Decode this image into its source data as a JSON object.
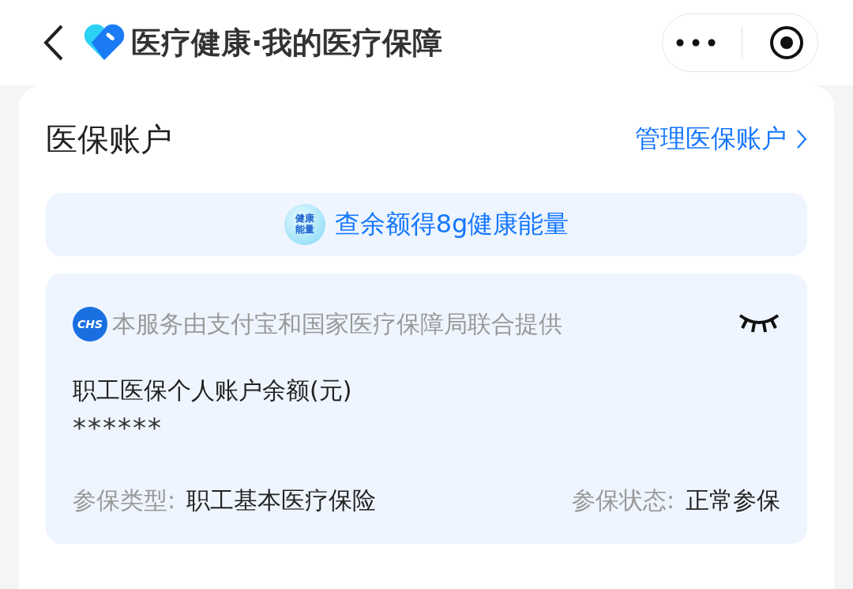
{
  "header": {
    "title": "医疗健康·我的医疗保障"
  },
  "account": {
    "title": "医保账户",
    "manage_link": "管理医保账户",
    "promo": {
      "badge": "健康能量",
      "text": "查余额得8g健康能量"
    },
    "card": {
      "logo": "CHS",
      "provider": "本服务由支付宝和国家医疗保障局联合提供",
      "balance_hidden": true,
      "balance_label": "职工医保个人账户余额(元)",
      "balance": "******",
      "fields": [
        {
          "label": "参保类型:",
          "value": "职工基本医疗保险"
        },
        {
          "label": "参保状态:",
          "value": "正常参保"
        }
      ]
    }
  }
}
